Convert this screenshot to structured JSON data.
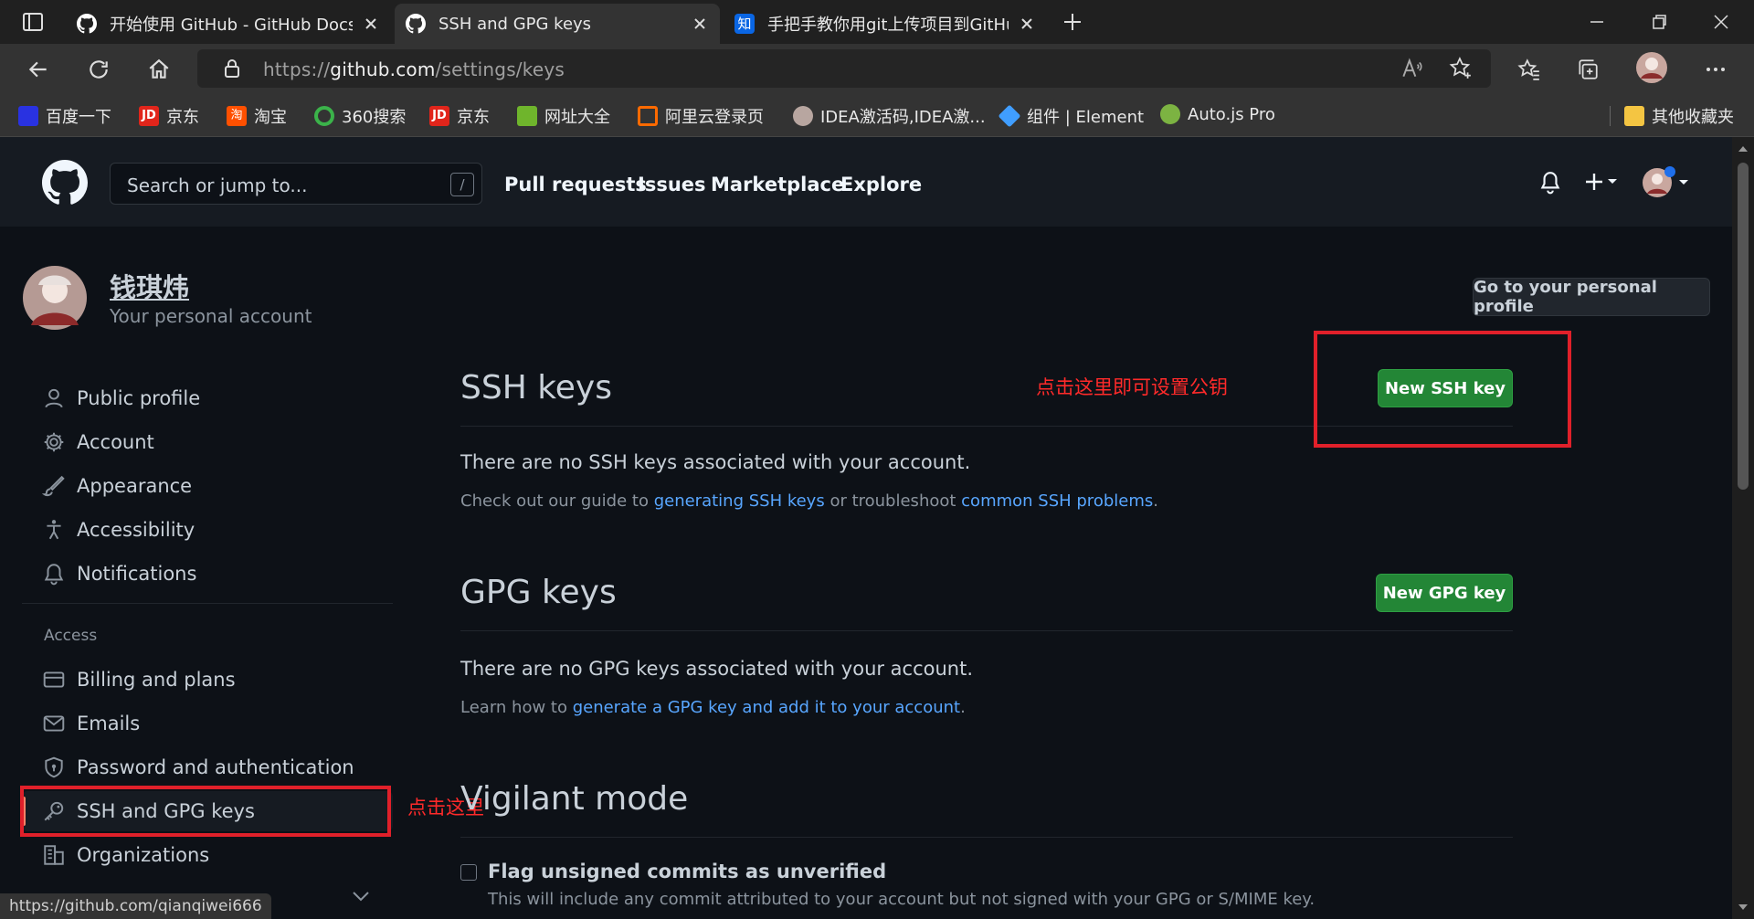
{
  "browser": {
    "tabs": [
      {
        "title": "开始使用 GitHub - GitHub Docs",
        "active": false
      },
      {
        "title": "SSH and GPG keys",
        "active": true
      },
      {
        "title": "手把手教你用git上传项目到GitHub",
        "active": false
      }
    ],
    "url_prefix": "https://",
    "url_domain": "github.com",
    "url_path": "/settings/keys",
    "bookmarks": [
      "百度一下",
      "京东",
      "淘宝",
      "360搜索",
      "京东",
      "网址大全",
      "阿里云登录页",
      "IDEA激活码,IDEA激...",
      "组件 | Element",
      "Auto.js Pro"
    ],
    "other_bookmarks": "其他收藏夹",
    "status_url": "https://github.com/qianqiwei666"
  },
  "github": {
    "search_placeholder": "Search or jump to...",
    "search_key": "/",
    "nav": [
      "Pull requests",
      "Issues",
      "Marketplace",
      "Explore"
    ]
  },
  "profile": {
    "name": "钱琪炜",
    "subtitle": "Your personal account",
    "go_profile": "Go to your personal profile"
  },
  "sidebar": {
    "items": [
      "Public profile",
      "Account",
      "Appearance",
      "Accessibility",
      "Notifications"
    ],
    "access_heading": "Access",
    "access_items": [
      "Billing and plans",
      "Emails",
      "Password and authentication",
      "SSH and GPG keys",
      "Organizations"
    ]
  },
  "ssh": {
    "title": "SSH keys",
    "button": "New SSH key",
    "empty": "There are no SSH keys associated with your account.",
    "help_pre": "Check out our guide to ",
    "help_link1": "generating SSH keys",
    "help_mid": " or troubleshoot ",
    "help_link2": "common SSH problems",
    "help_post": "."
  },
  "gpg": {
    "title": "GPG keys",
    "button": "New GPG key",
    "empty": "There are no GPG keys associated with your account.",
    "help_pre": "Learn how to ",
    "help_link": "generate a GPG key and add it to your account",
    "help_post": "."
  },
  "vigilant": {
    "title": "Vigilant mode",
    "checkbox_label": "Flag unsigned commits as unverified",
    "checkbox_desc": "This will include any commit attributed to your account but not signed with your GPG or S/MIME key."
  },
  "annotations": {
    "set_key": "点击这里即可设置公钥",
    "click_here": "点击这里"
  },
  "colors": {
    "annotation_red": "#e0202a",
    "primary_green": "#238636",
    "link_blue": "#58a6ff"
  }
}
